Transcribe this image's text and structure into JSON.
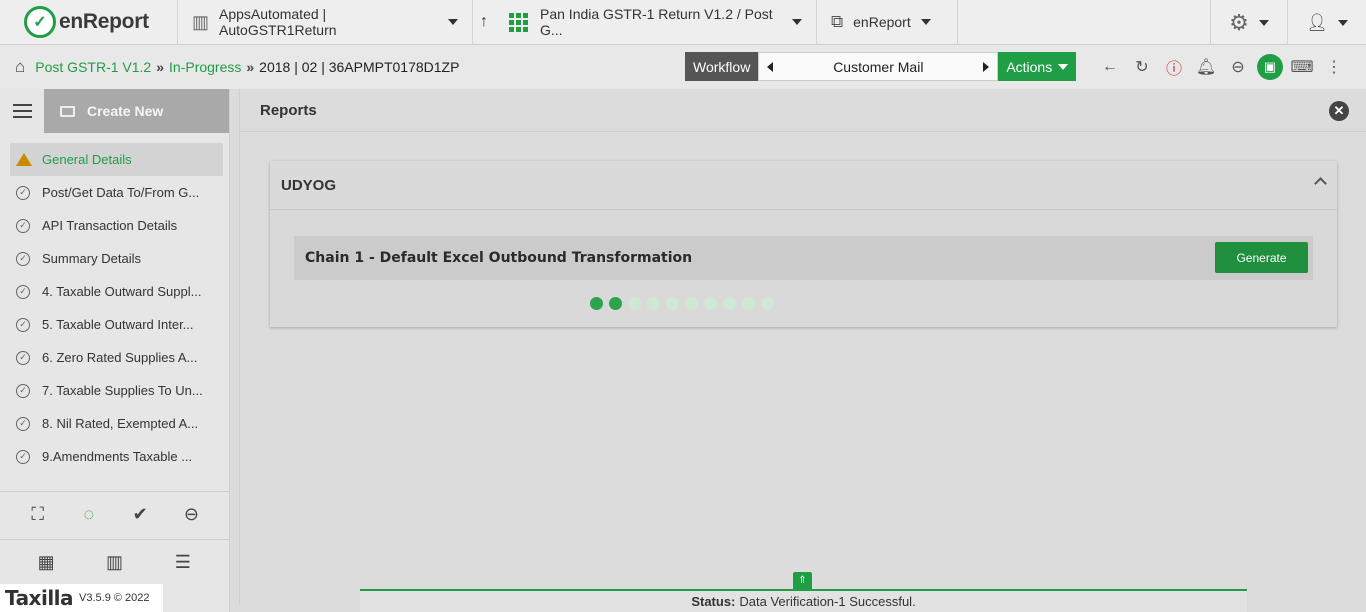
{
  "topbar": {
    "brand": "enReport",
    "org": "AppsAutomated | AutoGSTR1Return",
    "app": "Pan India GSTR-1 Return V1.2 / Post G...",
    "module": "enReport"
  },
  "breadcrumb": {
    "items": [
      "Post GSTR-1 V1.2",
      "In-Progress"
    ],
    "current": "2018 | 02 | 36APMPT0178D1ZP"
  },
  "workflow": {
    "label": "Workflow",
    "step": "Customer Mail",
    "actions": "Actions"
  },
  "sidebar": {
    "create_new": "Create New",
    "items": [
      {
        "label": "General Details"
      },
      {
        "label": "Post/Get Data To/From G..."
      },
      {
        "label": "API Transaction Details"
      },
      {
        "label": "Summary Details"
      },
      {
        "label": "4. Taxable Outward Suppl..."
      },
      {
        "label": "5. Taxable Outward Inter..."
      },
      {
        "label": "6. Zero Rated Supplies A..."
      },
      {
        "label": "7. Taxable Supplies To Un..."
      },
      {
        "label": "8. Nil Rated, Exempted A..."
      },
      {
        "label": "9.Amendments Taxable ..."
      }
    ]
  },
  "main": {
    "title": "Reports",
    "section": "UDYOG",
    "chain_label": "Chain 1 - Default Excel Outbound Transformation",
    "generate_label": "Generate"
  },
  "status": {
    "label": "Status:",
    "message": "Data Verification-1 Successful."
  },
  "footer": {
    "logo": "Taxilla",
    "version": "V3.5.9 © 2022"
  },
  "colors": {
    "accent": "#1f9e45",
    "warning": "#c98a00"
  }
}
